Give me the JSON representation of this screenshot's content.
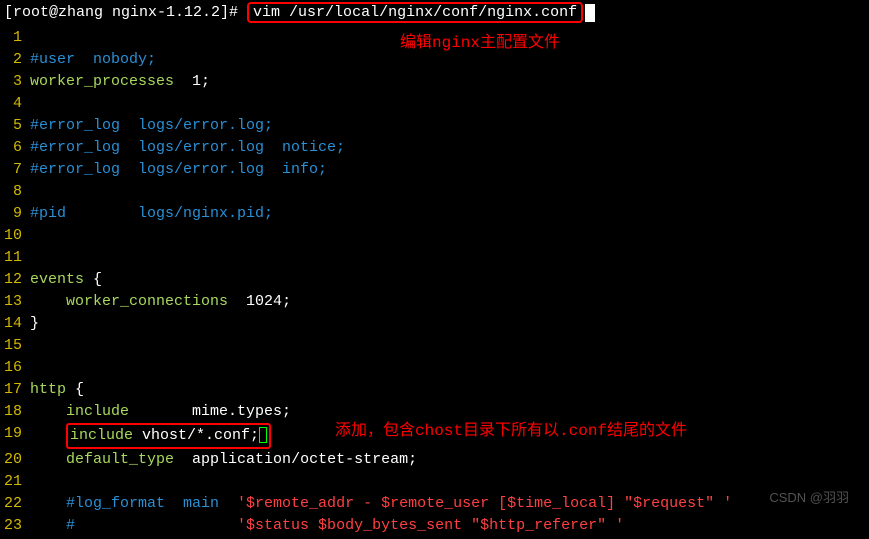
{
  "prompt": "[root@zhang nginx-1.12.2]# ",
  "command": "vim /usr/local/nginx/conf/nginx.conf",
  "annotations": {
    "edit_note": "编辑nginx主配置文件",
    "add_note": "添加，包含chost目录下所有以.conf结尾的文件"
  },
  "lines": [
    {
      "n": "1",
      "segments": []
    },
    {
      "n": "2",
      "segments": [
        {
          "cls": "c-comment",
          "t": "#user  nobody;"
        }
      ]
    },
    {
      "n": "3",
      "segments": [
        {
          "cls": "c-keyword",
          "t": "worker_processes  "
        },
        {
          "cls": "c-white",
          "t": "1"
        },
        {
          "cls": "c-white",
          "t": ";"
        }
      ]
    },
    {
      "n": "4",
      "segments": []
    },
    {
      "n": "5",
      "segments": [
        {
          "cls": "c-comment",
          "t": "#error_log  logs/error.log;"
        }
      ]
    },
    {
      "n": "6",
      "segments": [
        {
          "cls": "c-comment",
          "t": "#error_log  logs/error.log  notice;"
        }
      ]
    },
    {
      "n": "7",
      "segments": [
        {
          "cls": "c-comment",
          "t": "#error_log  logs/error.log  info;"
        }
      ]
    },
    {
      "n": "8",
      "segments": []
    },
    {
      "n": "9",
      "segments": [
        {
          "cls": "c-comment",
          "t": "#pid        logs/nginx.pid;"
        }
      ]
    },
    {
      "n": "10",
      "segments": []
    },
    {
      "n": "11",
      "segments": []
    },
    {
      "n": "12",
      "segments": [
        {
          "cls": "c-keyword",
          "t": "events "
        },
        {
          "cls": "c-white",
          "t": "{"
        }
      ]
    },
    {
      "n": "13",
      "segments": [
        {
          "cls": "c-white",
          "t": "    "
        },
        {
          "cls": "c-keyword",
          "t": "worker_connections  "
        },
        {
          "cls": "c-white",
          "t": "1024"
        },
        {
          "cls": "c-white",
          "t": ";"
        }
      ]
    },
    {
      "n": "14",
      "segments": [
        {
          "cls": "c-white",
          "t": "}"
        }
      ]
    },
    {
      "n": "15",
      "segments": []
    },
    {
      "n": "16",
      "segments": []
    },
    {
      "n": "17",
      "segments": [
        {
          "cls": "c-keyword",
          "t": "http "
        },
        {
          "cls": "c-white",
          "t": "{"
        }
      ]
    },
    {
      "n": "18",
      "segments": [
        {
          "cls": "c-white",
          "t": "    "
        },
        {
          "cls": "c-keyword",
          "t": "include       "
        },
        {
          "cls": "c-white",
          "t": "mime.types;"
        }
      ]
    },
    {
      "n": "19",
      "highlighted": true,
      "segments": [
        {
          "cls": "c-white",
          "t": "    "
        },
        {
          "cls": "c-keyword",
          "t": "include "
        },
        {
          "cls": "c-white",
          "t": "vhost/*.conf;"
        }
      ]
    },
    {
      "n": "20",
      "segments": [
        {
          "cls": "c-white",
          "t": "    "
        },
        {
          "cls": "c-keyword",
          "t": "default_type  "
        },
        {
          "cls": "c-white",
          "t": "application/octet-stream;"
        }
      ]
    },
    {
      "n": "21",
      "segments": []
    },
    {
      "n": "22",
      "segments": [
        {
          "cls": "c-white",
          "t": "    "
        },
        {
          "cls": "c-comment",
          "t": "#log_format  main  "
        },
        {
          "cls": "c-red",
          "t": "'$remote_addr - $remote_user [$time_local] \"$request\" '"
        }
      ]
    },
    {
      "n": "23",
      "segments": [
        {
          "cls": "c-white",
          "t": "    "
        },
        {
          "cls": "c-comment",
          "t": "#                  "
        },
        {
          "cls": "c-red",
          "t": "'$status $body_bytes_sent \"$http_referer\" '"
        }
      ]
    }
  ],
  "watermark": "CSDN @羽羽"
}
